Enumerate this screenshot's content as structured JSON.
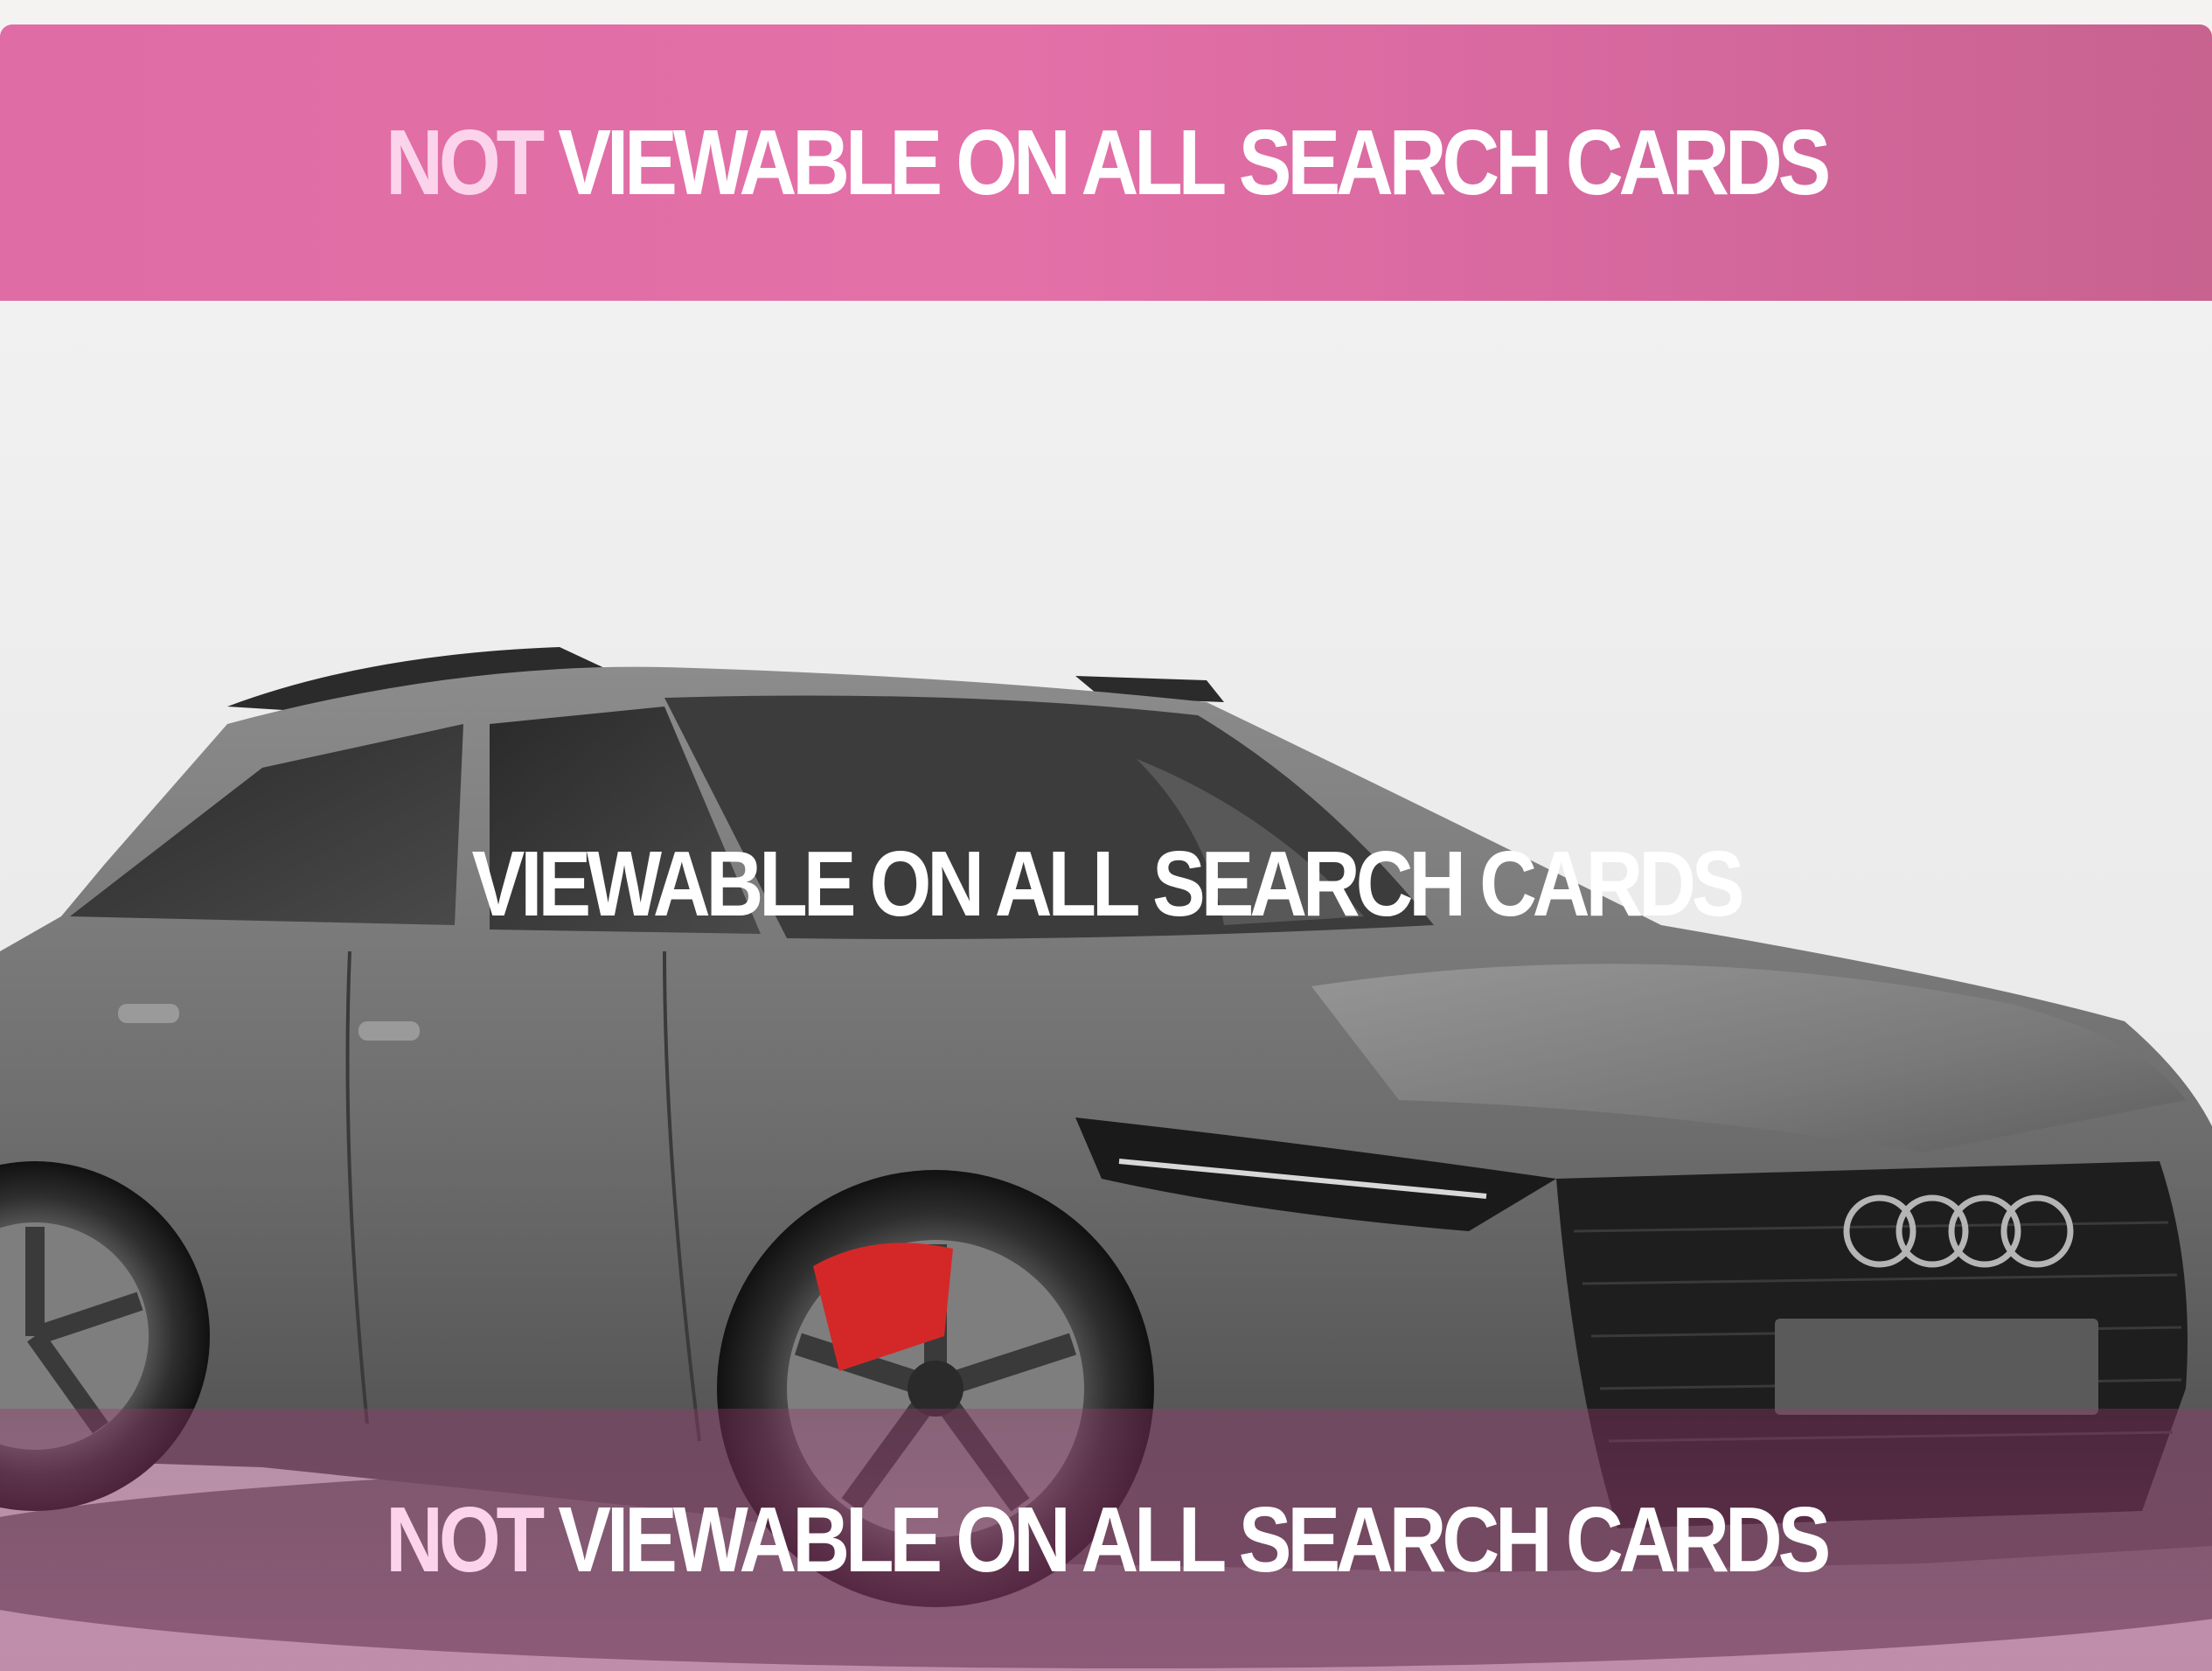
{
  "image": {
    "subject-icon": "grey-estate-car-photo",
    "accent_pink": "#e470a8"
  },
  "top_banner": {
    "accent_word": "NOT",
    "text": "VIEWABLE ON ALL SEARCH CARDS",
    "accent_color": "#fbd4ec"
  },
  "middle_overlay": {
    "text": "VIEWABLE ON ALL SEARCH CARDS"
  },
  "bottom_banner": {
    "accent_word": "NOT",
    "text": "VIEWABLE ON ALL SEARCH CARDS"
  }
}
